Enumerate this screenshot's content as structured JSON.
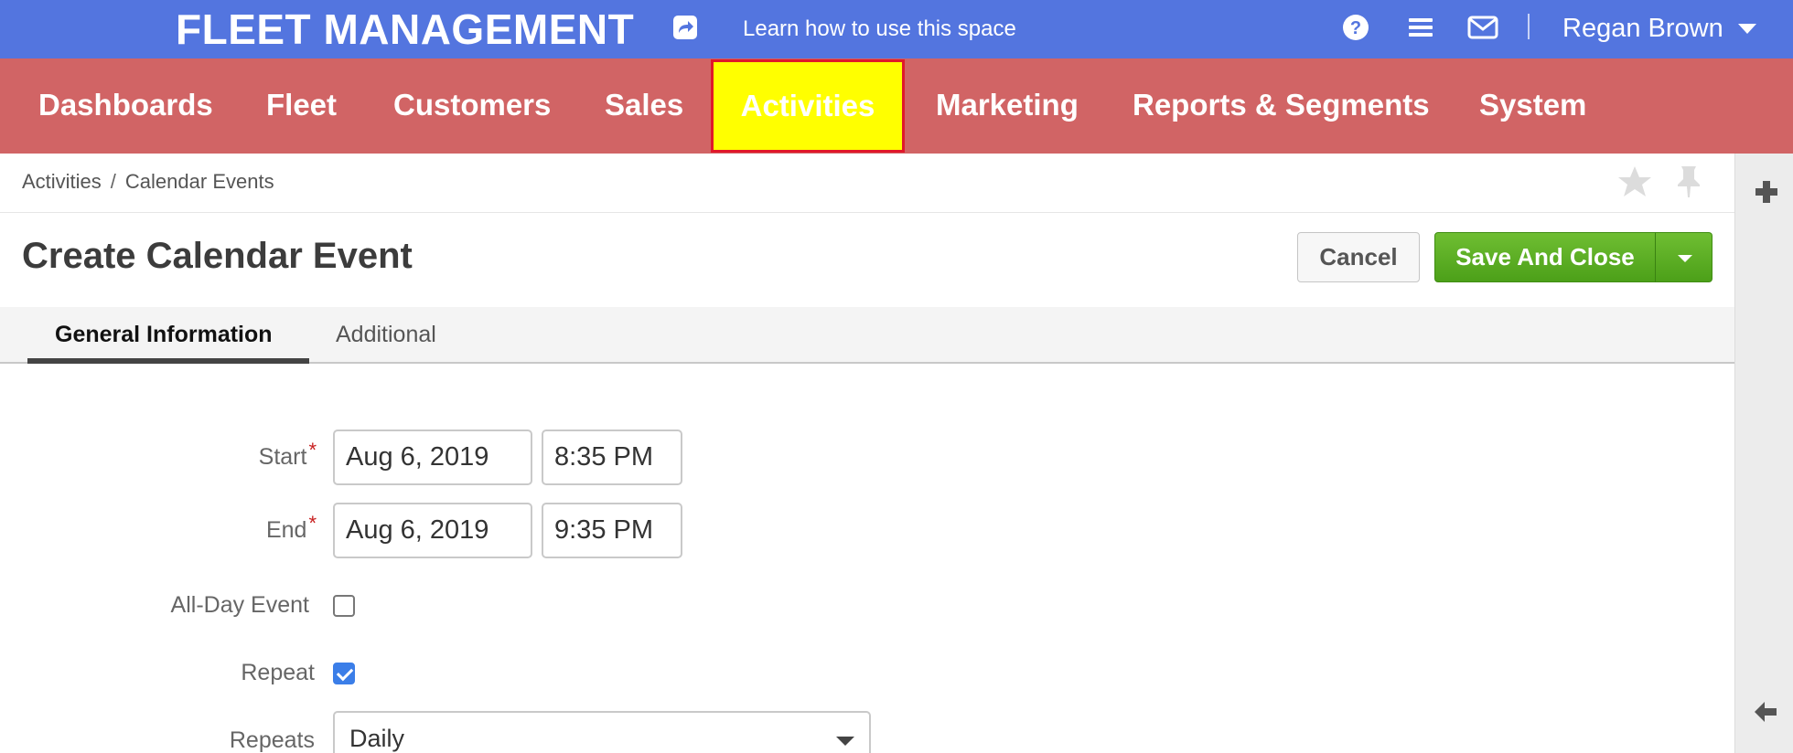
{
  "header": {
    "brand": "FLEET MANAGEMENT",
    "learn_link": "Learn how to use this space",
    "user_name": "Regan Brown",
    "colors": {
      "topbar": "#5375df",
      "mainnav": "#d16465",
      "active_nav": "#ffff00",
      "save_button": "#5aaa22"
    }
  },
  "nav": {
    "items": [
      {
        "label": "Dashboards"
      },
      {
        "label": "Fleet"
      },
      {
        "label": "Customers"
      },
      {
        "label": "Sales"
      },
      {
        "label": "Activities",
        "active": true
      },
      {
        "label": "Marketing"
      },
      {
        "label": "Reports & Segments"
      },
      {
        "label": "System"
      }
    ]
  },
  "breadcrumb": {
    "parent": "Activities",
    "separator": "/",
    "current": "Calendar Events"
  },
  "page": {
    "title": "Create Calendar Event",
    "cancel_label": "Cancel",
    "save_label": "Save And Close"
  },
  "tabs": [
    {
      "label": "General Information",
      "active": true
    },
    {
      "label": "Additional",
      "active": false
    }
  ],
  "form": {
    "start": {
      "label": "Start",
      "required_mark": "*",
      "date": "Aug 6, 2019",
      "time": "8:35 PM"
    },
    "end": {
      "label": "End",
      "required_mark": "*",
      "date": "Aug 6, 2019",
      "time": "9:35 PM"
    },
    "all_day": {
      "label": "All-Day Event",
      "checked": false
    },
    "repeat": {
      "label": "Repeat",
      "checked": true
    },
    "repeats": {
      "label": "Repeats",
      "value": "Daily"
    }
  },
  "icons": {
    "learn": "share-arrow-icon",
    "help": "question-circle-icon",
    "menu": "hamburger-menu-icon",
    "mail": "envelope-icon",
    "favorite": "star-icon",
    "pin": "pushpin-icon",
    "sidebar_add": "plus-icon",
    "sidebar_collapse": "arrow-left-icon"
  }
}
